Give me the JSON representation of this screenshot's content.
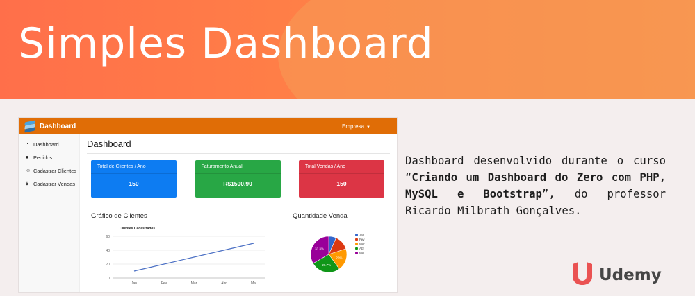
{
  "banner": {
    "title": "Simples Dashboard"
  },
  "dashboard": {
    "brand": "Dashboard",
    "menu": {
      "label": "Empresa",
      "caret": "▼"
    },
    "nav": [
      {
        "label": "Dashboard",
        "icon": "tachometer-icon"
      },
      {
        "label": "Pedidos",
        "icon": "briefcase-icon"
      },
      {
        "label": "Cadastrar Clientes",
        "icon": "user-icon"
      },
      {
        "label": "Cadastrar Vendas",
        "icon": "dollar-icon"
      }
    ],
    "page_title": "Dashboard",
    "cards": [
      {
        "title": "Total de Clientes / Ano",
        "value": "150",
        "color": "#0d7cf2"
      },
      {
        "title": "Faturamento Anual",
        "value": "R$1500.90",
        "color": "#28a745"
      },
      {
        "title": "Total Vendas / Ano",
        "value": "150",
        "color": "#dc3545"
      }
    ]
  },
  "chart_data": [
    {
      "type": "line",
      "heading": "Gráfico de Clientes",
      "title": "Clientes Cadastrados",
      "categories": [
        "Jan",
        "Fev",
        "Mar",
        "Abr",
        "Mai"
      ],
      "series": [
        {
          "values": [
            10,
            20,
            30,
            40,
            50
          ],
          "color": "#4a6fc4"
        }
      ],
      "ylim": [
        0,
        60
      ],
      "yticks": [
        0,
        20,
        40,
        60
      ],
      "grid": true
    },
    {
      "type": "pie",
      "heading": "Quantidade Venda",
      "labels": [
        "Jan",
        "Fev",
        "Mar",
        "Abr",
        "Mai"
      ],
      "values": [
        6.7,
        13.3,
        20,
        26.7,
        33.3
      ],
      "slice_labels": [
        "",
        "",
        "20%",
        "26.7%",
        "33.3%"
      ],
      "colors": [
        "#3366cc",
        "#dc3912",
        "#ff9900",
        "#109618",
        "#990099"
      ],
      "legend": "right"
    }
  ],
  "description": {
    "pre": "Dashboard desenvolvido durante o curso “",
    "bold": "Criando um Dashboard do Zero com PHP, MySQL e Bootstrap",
    "post": "”, do professor Ricardo Milbrath Gonçalves."
  },
  "logo": {
    "word": "Udemy",
    "icon": "udemy-logo-icon",
    "color": "#ea5252"
  }
}
